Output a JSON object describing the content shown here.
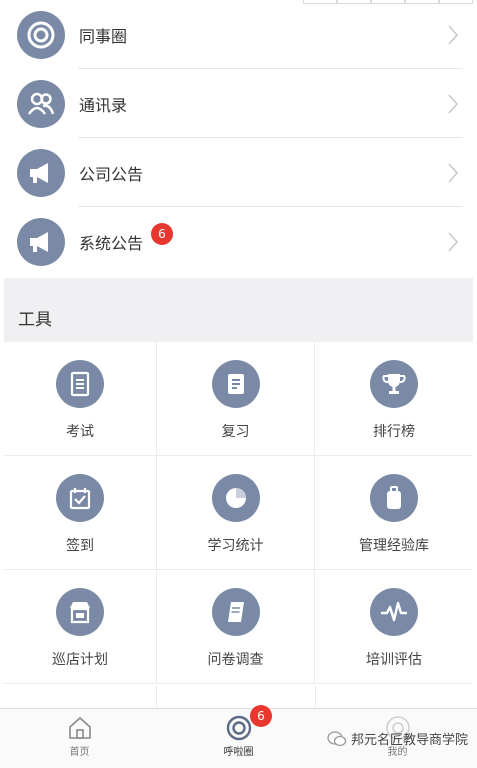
{
  "menu": [
    {
      "label": "同事圈",
      "icon": "ring-icon"
    },
    {
      "label": "通讯录",
      "icon": "contacts-icon"
    },
    {
      "label": "公司公告",
      "icon": "megaphone-icon"
    },
    {
      "label": "系统公告",
      "icon": "megaphone-icon",
      "badge": "6"
    }
  ],
  "section": {
    "title": "工具"
  },
  "tools": [
    {
      "label": "考试",
      "icon": "exam-icon"
    },
    {
      "label": "复习",
      "icon": "review-icon"
    },
    {
      "label": "排行榜",
      "icon": "trophy-icon"
    },
    {
      "label": "签到",
      "icon": "checkin-icon"
    },
    {
      "label": "学习统计",
      "icon": "pie-chart-icon"
    },
    {
      "label": "管理经验库",
      "icon": "luggage-icon"
    },
    {
      "label": "巡店计划",
      "icon": "store-icon"
    },
    {
      "label": "问卷调查",
      "icon": "scroll-icon"
    },
    {
      "label": "培训评估",
      "icon": "pulse-icon"
    }
  ],
  "tabs": [
    {
      "label": "首页",
      "icon": "home-icon"
    },
    {
      "label": "呼啦圈",
      "icon": "ring-icon",
      "badge": "6"
    },
    {
      "label": "我的",
      "icon": "profile-icon"
    }
  ],
  "watermark": {
    "text": "邦元名匠教导商学院"
  },
  "colors": {
    "icon_bg": "#7a8aa6",
    "badge": "#e8372e",
    "section_bg": "#f0f0f2"
  }
}
